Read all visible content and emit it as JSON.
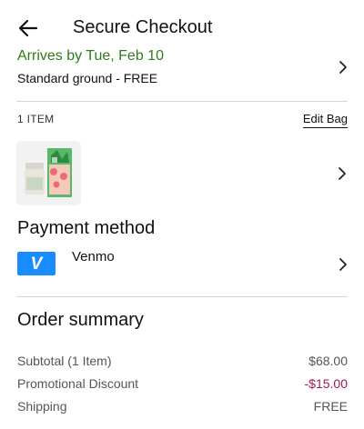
{
  "header": {
    "title": "Secure Checkout"
  },
  "delivery": {
    "arrives": "Arrives by Tue, Feb 10",
    "method": "Standard ground - FREE"
  },
  "bag": {
    "item_count": "1 ITEM",
    "edit_label": "Edit Bag"
  },
  "payment": {
    "heading": "Payment method",
    "logo_letter": "V",
    "method_label": "Venmo"
  },
  "summary": {
    "heading": "Order summary",
    "rows": [
      {
        "label": "Subtotal (1 Item)",
        "value": "$68.00"
      },
      {
        "label": "Promotional Discount",
        "value": "-$15.00"
      },
      {
        "label": "Shipping",
        "value": "FREE"
      }
    ]
  },
  "colors": {
    "arrives_green": "#2e7d16",
    "discount_magenta": "#a3155c",
    "venmo_blue": "#1a8cff",
    "divider": "#d6d6d6"
  },
  "icons": {
    "back": "arrow-left-icon",
    "chevron": "chevron-right-icon"
  }
}
